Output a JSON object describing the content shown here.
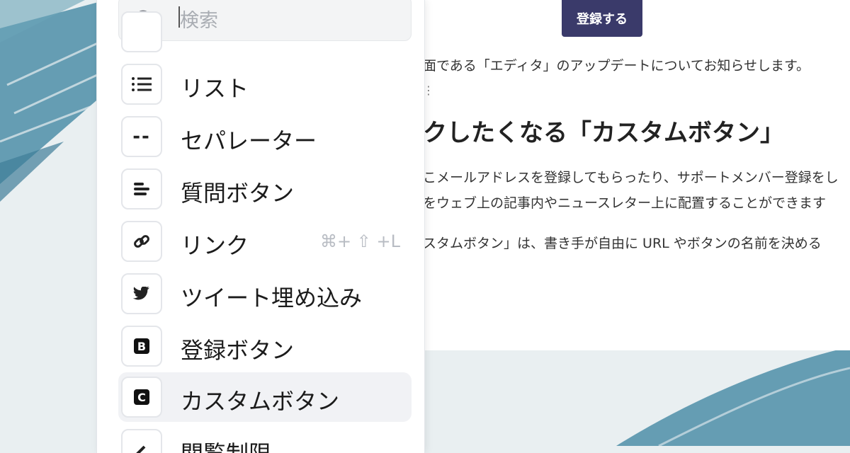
{
  "colors": {
    "accent": "#3a3a6a",
    "brush": "#4e8ea8",
    "selected_bg": "#f1f2f5"
  },
  "header": {
    "register_label": "登録する"
  },
  "article": {
    "line1": "面である「エディタ」のアップデートについてお知らせします。",
    "heading": "クしたくなる「カスタムボタン」",
    "line2": "こメールアドレスを登録してもらったり、サポートメンバー登録をし",
    "line3": "をウェブ上の記事内やニュースレター上に配置することができます",
    "line4": "スタムボタン」は、書き手が自由に URL やボタンの名前を決める"
  },
  "menu": {
    "search_placeholder": "検索",
    "items": [
      {
        "label": "リスト",
        "icon": "list-icon"
      },
      {
        "label": "セパレーター",
        "icon": "separator-icon",
        "glyph": "--"
      },
      {
        "label": "質問ボタン",
        "icon": "question-button-icon"
      },
      {
        "label": "リンク",
        "icon": "link-icon",
        "shortcut": "⌘+ ⇧ +L"
      },
      {
        "label": "ツイート埋め込み",
        "icon": "twitter-icon"
      },
      {
        "label": "登録ボタン",
        "icon": "register-button-icon",
        "glyph": "B"
      },
      {
        "label": "カスタムボタン",
        "icon": "custom-button-icon",
        "glyph": "C",
        "selected": true
      },
      {
        "label": "閲覧制限",
        "icon": "restriction-icon"
      }
    ]
  }
}
